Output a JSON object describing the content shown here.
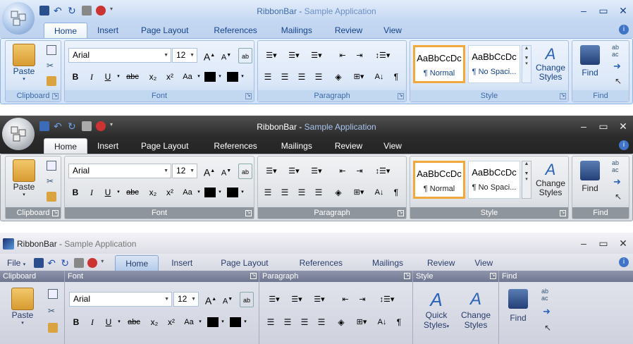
{
  "app_title": "RibbonBar",
  "app_subtitle": "Sample Application",
  "title_sep": " - ",
  "window_controls": [
    "–",
    "▭",
    "✕"
  ],
  "tabs": [
    "Home",
    "Insert",
    "Page Layout",
    "References",
    "Mailings",
    "Review",
    "View"
  ],
  "file_menu": "File",
  "groups": {
    "clipboard": "Clipboard",
    "font": "Font",
    "paragraph": "Paragraph",
    "style": "Style",
    "find": "Find"
  },
  "clipboard": {
    "paste": "Paste"
  },
  "font": {
    "name": "Arial",
    "size": "12",
    "grow": "A",
    "shrink": "A",
    "bold": "B",
    "italic": "I",
    "underline": "U",
    "strike": "abc",
    "subscript": "x₂",
    "superscript": "x²",
    "change_case": "Aa"
  },
  "styles": [
    {
      "preview": "AaBbCcDc",
      "name": "¶ Normal"
    },
    {
      "preview": "AaBbCcDc",
      "name": "¶ No Spaci..."
    }
  ],
  "change_styles": [
    "Change",
    "Styles"
  ],
  "quick_styles": [
    "Quick",
    "Styles"
  ],
  "find": {
    "label": "Find"
  },
  "colors": {
    "accent_blue": "#15428b",
    "selected_style": "#f2a93b"
  }
}
